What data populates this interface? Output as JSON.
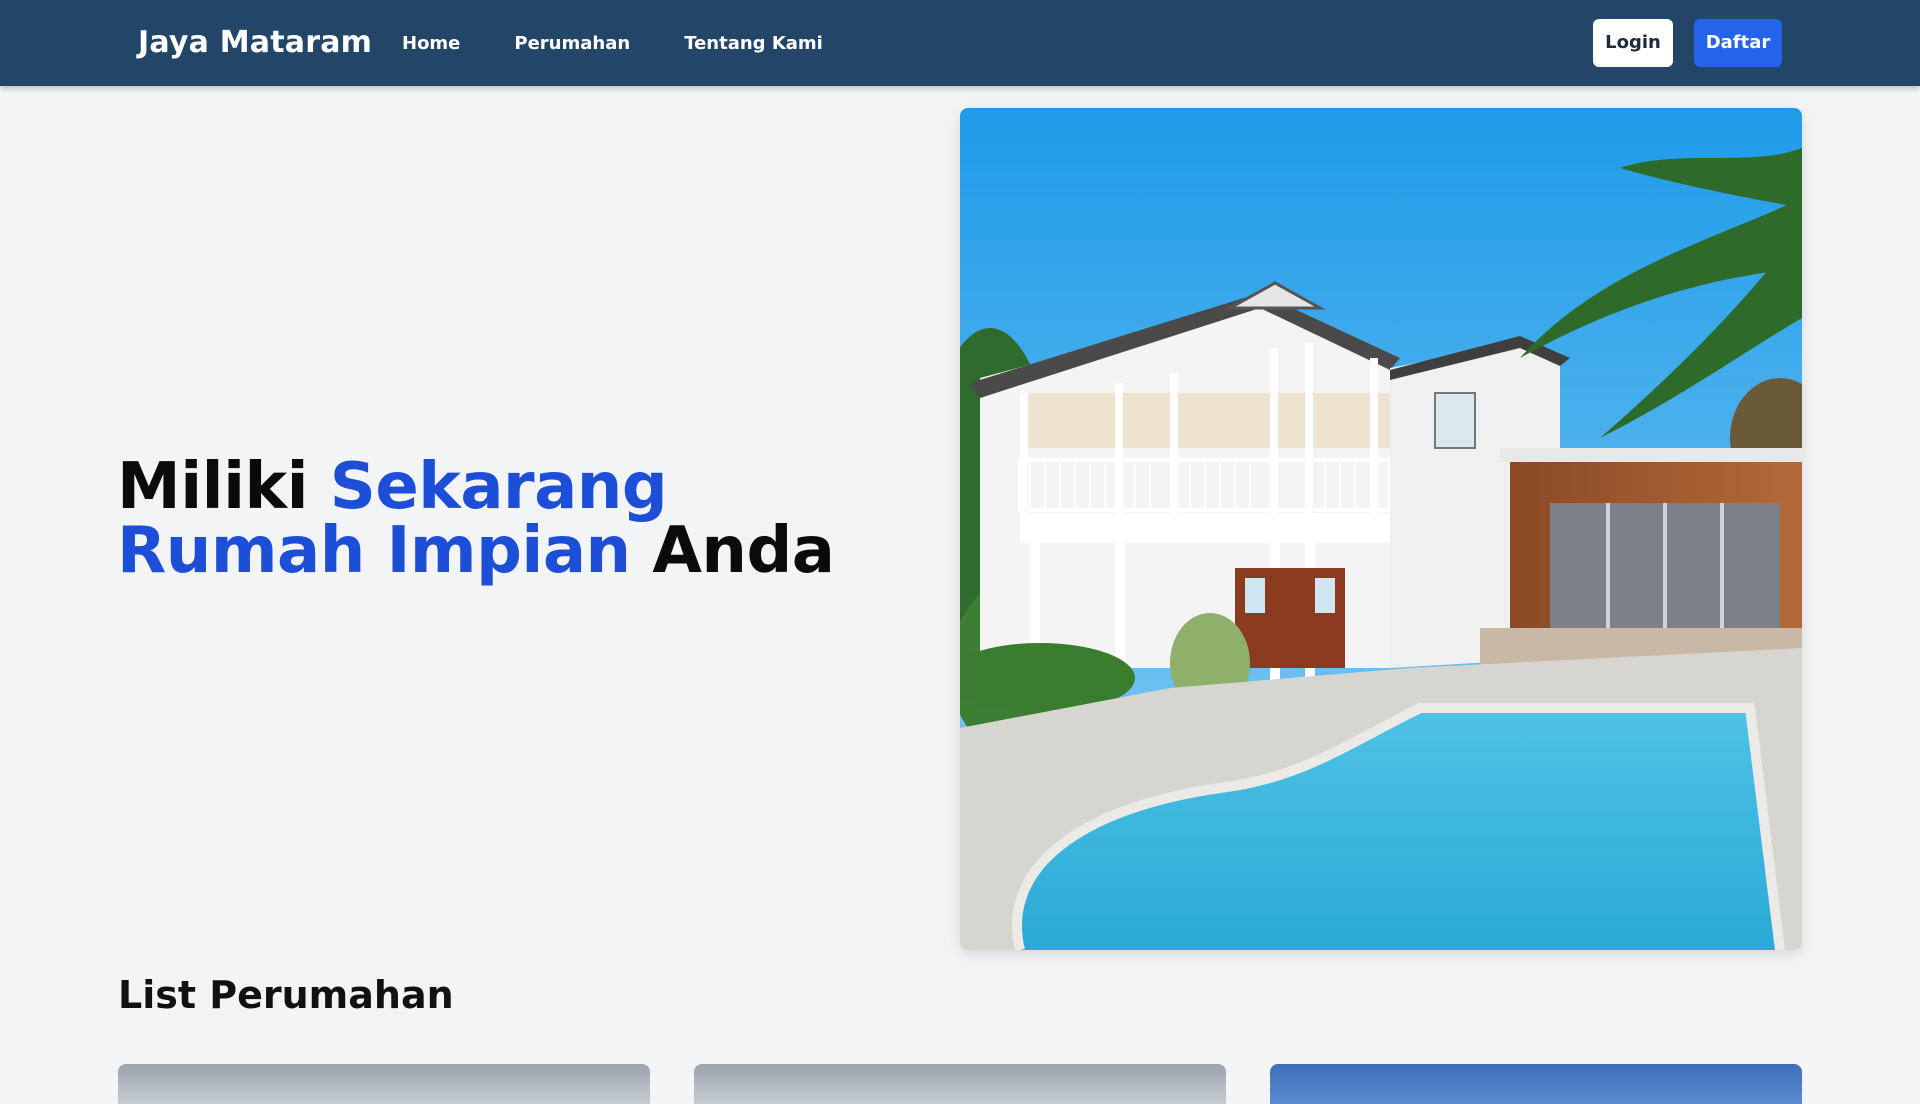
{
  "navbar": {
    "brand": "Jaya Mataram",
    "links": [
      {
        "label": "Home"
      },
      {
        "label": "Perumahan"
      },
      {
        "label": "Tentang Kami"
      }
    ],
    "login_label": "Login",
    "register_label": "Daftar",
    "colors": {
      "background": "#234567",
      "register_button": "#2563eb"
    }
  },
  "hero": {
    "title_part1": "Miliki ",
    "title_accent": "Sekarang Rumah Impian",
    "title_part2": " Anda",
    "accent_color": "#1d4ed8",
    "image": "house-with-pool-photo"
  },
  "listing": {
    "title": "List Perumahan",
    "cards": [
      {
        "image": "property-photo"
      },
      {
        "image": "property-photo"
      },
      {
        "image": "property-photo"
      }
    ]
  }
}
